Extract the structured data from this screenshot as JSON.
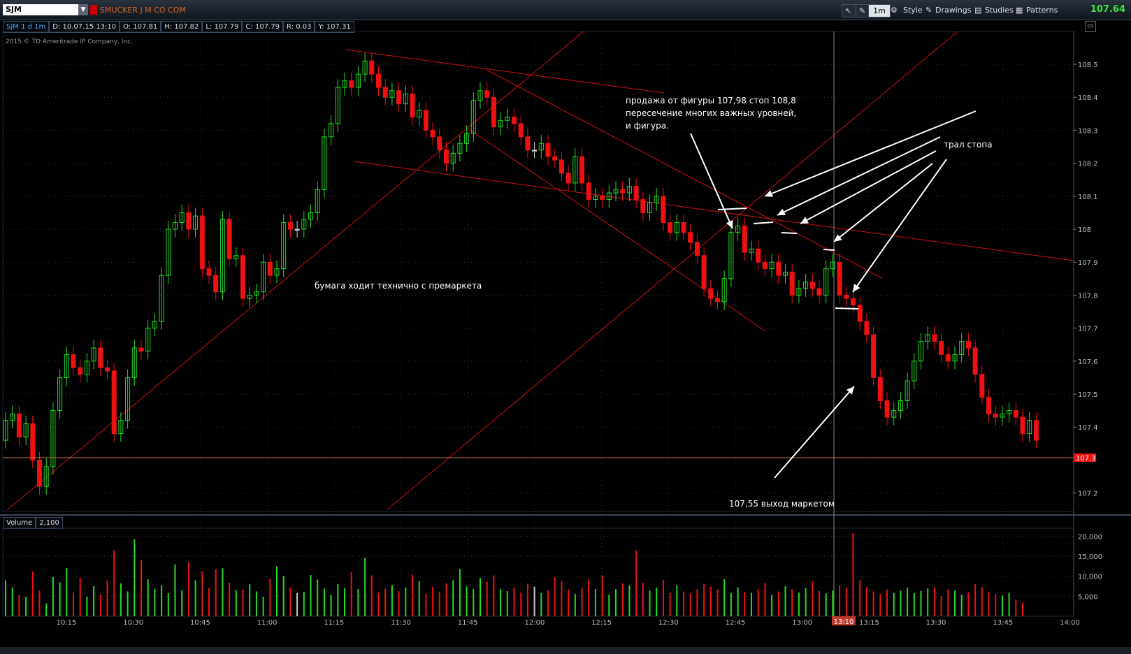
{
  "toolbar": {
    "symbol": "SJM",
    "company": "SMUCKER J M CO COM",
    "timeframe": "1m",
    "style_label": "Style",
    "drawings_label": "Drawings",
    "studies_label": "Studies",
    "patterns_label": "Patterns",
    "last_price": "107.64"
  },
  "infobar": {
    "title": "SJM 1 d 1m",
    "date": "D: 10.07.15 13:10",
    "open": "O: 107.81",
    "high": "H: 107.82",
    "low": "L: 107.79",
    "close": "C: 107.79",
    "range": "R: 0.03",
    "y": "Y: 107.31"
  },
  "copyright": "2015 © TD Ameritrade IP Company, Inc.",
  "volume_bar": {
    "label": "Volume",
    "value": "2,100"
  },
  "cursor_time": "13:10",
  "price_marker": "107.3",
  "colors": {
    "up": "#22dd22",
    "down": "#ee1111",
    "neutral": "#cccccc",
    "trendline": "#cc1111",
    "background": "#000000",
    "annotation": "#ffffff"
  },
  "annotations": {
    "trade_line1": "продажа от фигуры 107,98 стоп 108,8",
    "trade_line2": "пересечение многих важных уровней,",
    "trade_line3": "и фигура.",
    "trail": "трал стопа",
    "premarket": "бумага ходит технично с премаркета",
    "exit": "107,55 выход маркетом"
  },
  "chart_data": {
    "type": "candlestick",
    "ylim": [
      107.15,
      108.6
    ],
    "y_ticks": [
      "108.5",
      "108.4",
      "108.3",
      "108.2",
      "108.1",
      "108",
      "107.9",
      "107.8",
      "107.7",
      "107.6",
      "107.5",
      "107.4",
      "107.2"
    ],
    "x_ticks": [
      "10:15",
      "10:30",
      "10:45",
      "11:00",
      "11:15",
      "11:30",
      "11:45",
      "12:00",
      "12:15",
      "12:30",
      "12:45",
      "13:00",
      "13:15",
      "13:30",
      "13:45",
      "14:00"
    ],
    "volume_ticks": [
      "20,000",
      "15,000",
      "10,000",
      "5,000"
    ],
    "volume_ylim": [
      0,
      22000
    ],
    "closes": [
      107.42,
      107.44,
      107.37,
      107.41,
      107.3,
      107.22,
      107.28,
      107.45,
      107.55,
      107.62,
      107.58,
      107.56,
      107.6,
      107.64,
      107.58,
      107.57,
      107.38,
      107.42,
      107.55,
      107.64,
      107.63,
      107.7,
      107.72,
      107.86,
      108.0,
      108.02,
      108.05,
      108.0,
      108.04,
      107.88,
      107.86,
      107.81,
      108.03,
      107.91,
      107.92,
      107.79,
      107.8,
      107.81,
      107.9,
      107.86,
      107.88,
      108.02,
      108.0,
      108.0,
      108.03,
      108.05,
      108.12,
      108.28,
      108.32,
      108.43,
      108.45,
      108.43,
      108.47,
      108.51,
      108.47,
      108.43,
      108.4,
      108.42,
      108.38,
      108.41,
      108.34,
      108.36,
      108.3,
      108.28,
      108.24,
      108.2,
      108.23,
      108.26,
      108.29,
      108.39,
      108.42,
      108.4,
      108.31,
      108.33,
      108.34,
      108.32,
      108.28,
      108.24,
      108.24,
      108.26,
      108.22,
      108.21,
      108.17,
      108.14,
      108.22,
      108.14,
      108.09,
      108.1,
      108.09,
      108.11,
      108.12,
      108.11,
      108.13,
      108.09,
      108.05,
      108.08,
      108.1,
      108.02,
      107.99,
      108.02,
      107.99,
      107.96,
      107.92,
      107.82,
      107.79,
      107.78,
      107.85,
      107.99,
      108.01,
      107.93,
      107.94,
      107.9,
      107.88,
      107.9,
      107.86,
      107.87,
      107.8,
      107.82,
      107.84,
      107.82,
      107.8,
      107.88,
      107.9,
      107.8,
      107.79,
      107.77,
      107.72,
      107.68,
      107.55,
      107.48,
      107.43,
      107.45,
      107.48,
      107.54,
      107.6,
      107.66,
      107.68,
      107.66,
      107.62,
      107.6,
      107.62,
      107.66,
      107.64,
      107.56,
      107.49,
      107.44,
      107.43,
      107.44,
      107.45,
      107.43,
      107.38,
      107.42,
      107.36
    ],
    "volumes": [
      9000,
      7200,
      5300,
      4800,
      11200,
      6400,
      3200,
      9800,
      8500,
      12100,
      6000,
      9600,
      4900,
      7500,
      5500,
      9000,
      16500,
      8200,
      6200,
      19200,
      14000,
      9200,
      6800,
      7800,
      5800,
      13000,
      6500,
      13500,
      9000,
      11200,
      7000,
      11800,
      12000,
      8400,
      6500,
      6800,
      8000,
      6200,
      4900,
      9400,
      12500,
      10100,
      7200,
      5800,
      6100,
      10300,
      9200,
      6900,
      5400,
      8100,
      7000,
      11000,
      6800,
      14600,
      10200,
      5900,
      6900,
      7800,
      6300,
      7200,
      10400,
      8800,
      5600,
      7400,
      6100,
      8200,
      9000,
      11800,
      7500,
      6800,
      9600,
      8700,
      10200,
      6800,
      6300,
      7200,
      5900,
      8100,
      7400,
      5800,
      6500,
      9800,
      8700,
      6700,
      5600,
      7100,
      9200,
      6800,
      10200,
      5400,
      6800,
      8200,
      7700,
      16500,
      8300,
      6400,
      7200,
      9100,
      5900,
      7800,
      6200,
      5700,
      6800,
      8100,
      7400,
      6700,
      9300,
      5800,
      7200,
      6100,
      5900,
      6700,
      8300,
      5400,
      6200,
      7500,
      6800,
      5900,
      7000,
      8800,
      6300,
      5700,
      6400,
      7700,
      7100,
      20800,
      9000,
      7300,
      6200,
      5600,
      6700,
      5900,
      6400,
      7200,
      5800,
      6300,
      6900,
      7200,
      5100,
      6800,
      6400,
      5400,
      6000,
      8000,
      7300,
      6100,
      5600,
      5200,
      5900,
      4100,
      3400
    ]
  }
}
